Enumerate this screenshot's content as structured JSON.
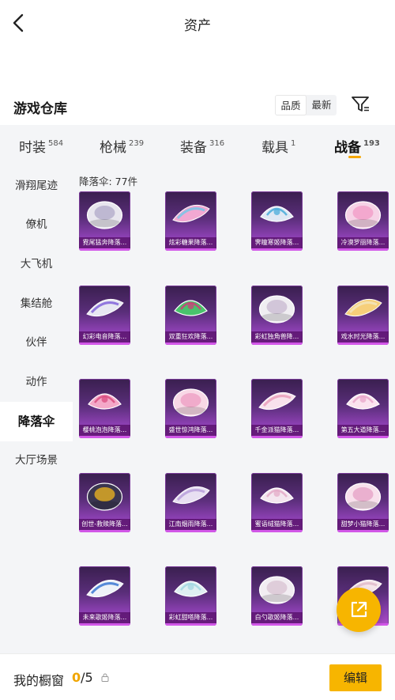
{
  "header": {
    "title": "资产"
  },
  "section": {
    "title": "游戏仓库",
    "sort_quality": "品质",
    "sort_latest": "最新"
  },
  "tabs": [
    {
      "label": "时装",
      "count": "584"
    },
    {
      "label": "枪械",
      "count": "239"
    },
    {
      "label": "装备",
      "count": "316"
    },
    {
      "label": "载具",
      "count": "1"
    },
    {
      "label": "战备",
      "count": "193"
    }
  ],
  "sidebar": [
    {
      "label": "滑翔尾迹"
    },
    {
      "label": "僚机"
    },
    {
      "label": "大飞机"
    },
    {
      "label": "集结舱"
    },
    {
      "label": "伙伴"
    },
    {
      "label": "动作"
    },
    {
      "label": "降落伞"
    },
    {
      "label": "大厅场景"
    }
  ],
  "content": {
    "count_label": "降落伞: 77件"
  },
  "items": [
    {
      "label": "霓尾猛奔降落...",
      "color": "#e8e6ee",
      "accent": "#b0a8c8"
    },
    {
      "label": "炫彩糖果降落...",
      "color": "#f2a8d2",
      "accent": "#6ec8e8"
    },
    {
      "label": "霁瞳寒姬降落...",
      "color": "#dfe8f4",
      "accent": "#3fa8d8"
    },
    {
      "label": "冷漠罗丽降落...",
      "color": "#f6d2e6",
      "accent": "#f29ac6"
    },
    {
      "label": "幻彩电音降落...",
      "color": "#e8e8f2",
      "accent": "#7a5ad8"
    },
    {
      "label": "双重狂欢降落...",
      "color": "#49c26c",
      "accent": "#d8347a"
    },
    {
      "label": "彩虹独角兽降...",
      "color": "#f0eef2",
      "accent": "#c8b8d0"
    },
    {
      "label": "戏水时光降落...",
      "color": "#f6cf7a",
      "accent": "#f2e6c0"
    },
    {
      "label": "樱桃泡泡降落...",
      "color": "#f4a8c8",
      "accent": "#d8467a"
    },
    {
      "label": "盛世惊鸿降落...",
      "color": "#f8d8e6",
      "accent": "#ee9cc2"
    },
    {
      "label": "千金派猫降落...",
      "color": "#f8e2ec",
      "accent": "#e89ab8"
    },
    {
      "label": "第五大道降落...",
      "color": "#fbe2ee",
      "accent": "#e8a2c8"
    },
    {
      "label": "创世-救赎降落...",
      "color": "#3a3550",
      "accent": "#f2b81e"
    },
    {
      "label": "江南烟雨降落...",
      "color": "#e8dff2",
      "accent": "#b49ad8"
    },
    {
      "label": "蜜语绒猫降落...",
      "color": "#f4e6ef",
      "accent": "#e2a6c4"
    },
    {
      "label": "甜梦小猫降落...",
      "color": "#f8e0ec",
      "accent": "#e6a0c6"
    },
    {
      "label": "未来歌姬降落...",
      "color": "#eef2f8",
      "accent": "#2f6fd0"
    },
    {
      "label": "彩虹甜嗒降落...",
      "color": "#dfeff2",
      "accent": "#9ed6e0"
    },
    {
      "label": "白勺歌姬降落...",
      "color": "#f2edf2",
      "accent": "#d8c2d2"
    },
    {
      "label": "",
      "color": "#f6e6ea",
      "accent": "#e0b8c8"
    }
  ],
  "footer": {
    "label": "我的橱窗",
    "count_current": "0",
    "count_total": "/5",
    "edit_label": "编辑"
  }
}
